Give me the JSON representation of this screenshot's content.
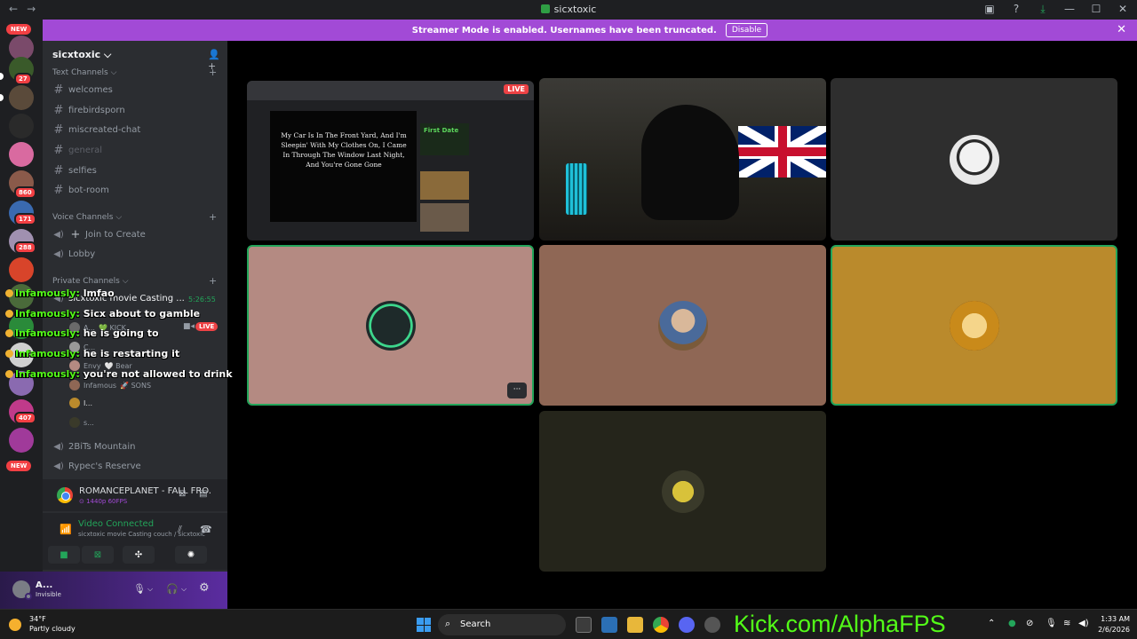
{
  "window": {
    "title": "sicxtoxic",
    "nav_back": "←",
    "nav_forward": "→",
    "icons": [
      "inbox-icon",
      "help-icon",
      "download-icon",
      "minimize-icon",
      "maximize-icon",
      "close-icon"
    ],
    "minimize": "—",
    "maximize": "☐",
    "close": "✕",
    "inbox": "▣",
    "help": "?",
    "download": "⤓"
  },
  "banner": {
    "text": "Streamer Mode is enabled. Usernames have been truncated.",
    "button": "Disable",
    "close": "✕"
  },
  "guilds": {
    "new_top": "NEW",
    "new_bottom": "NEW",
    "badges": [
      "27",
      "860",
      "171",
      "288",
      "407"
    ]
  },
  "sidebar": {
    "server_name": "sicxtoxic",
    "server_chevron": "⌵",
    "text_category": "Text Channels",
    "text_channels": [
      "welcomes",
      "firebirdsporn",
      "miscreated-chat",
      "general",
      "selfies",
      "bot-room"
    ],
    "voice_category": "Voice Channels",
    "join_to_create": "Join to Create",
    "lobby": "Lobby",
    "private_category": "Private Channels",
    "casting_channel": "sicxtoxic movie Casting ...",
    "casting_time": "5:26:55",
    "live": "LIVE",
    "voice_users": [
      {
        "name": "A...",
        "extra": "💚 KICK"
      },
      {
        "name": "C..."
      },
      {
        "name": "Envy",
        "extra": "🤍 Bear"
      },
      {
        "name": "Infamous",
        "extra": "🚀 SONS"
      },
      {
        "name": "I..."
      },
      {
        "name": "s..."
      }
    ],
    "more_channels": [
      "2BiTs Mountain",
      "Rypec's Reserve"
    ]
  },
  "overlay_chat": [
    {
      "user": "Infamously:",
      "msg": "lmfao"
    },
    {
      "user": "Infamously:",
      "msg": "Sicx about to gamble"
    },
    {
      "user": "Infamously:",
      "msg": "he is going to"
    },
    {
      "user": "Infamously:",
      "msg": "he is restarting it"
    },
    {
      "user": "Infamously:",
      "msg": "you're not allowed to drink"
    }
  ],
  "activity": {
    "title": "ROMANCEPLANET - FALL FRO...",
    "quality": "⊙ 1440p 60FPS"
  },
  "voice_panel": {
    "status": "Video Connected",
    "location": "sicxtoxic movie Casting couch / sicxtoxic"
  },
  "user": {
    "name": "A...",
    "status": "Invisible"
  },
  "stream": {
    "live": "LIVE",
    "lyrics": "My Car Is In The Front Yard, And I'm Sleepin' With My Clothes On, I Came In Through The Window Last Night, And You're Gone Gone",
    "first_date": "First Date",
    "more": "···"
  },
  "taskbar": {
    "weather_temp": "34°F",
    "weather_desc": "Partly cloudy",
    "search": "Search",
    "time": "1:33 AM",
    "date": "2/6/2026"
  },
  "watermark": "Kick.com/AlphaFPS",
  "colors": {
    "accent": "#a24ad6",
    "speaking": "#23a55a",
    "kick_green": "#53fc18",
    "tile_pink": "#b48a82",
    "tile_brown": "#8f6755",
    "tile_gold": "#ba8a2c",
    "tile_olive": "#25251b",
    "tile_gray": "#2e2e2e"
  }
}
